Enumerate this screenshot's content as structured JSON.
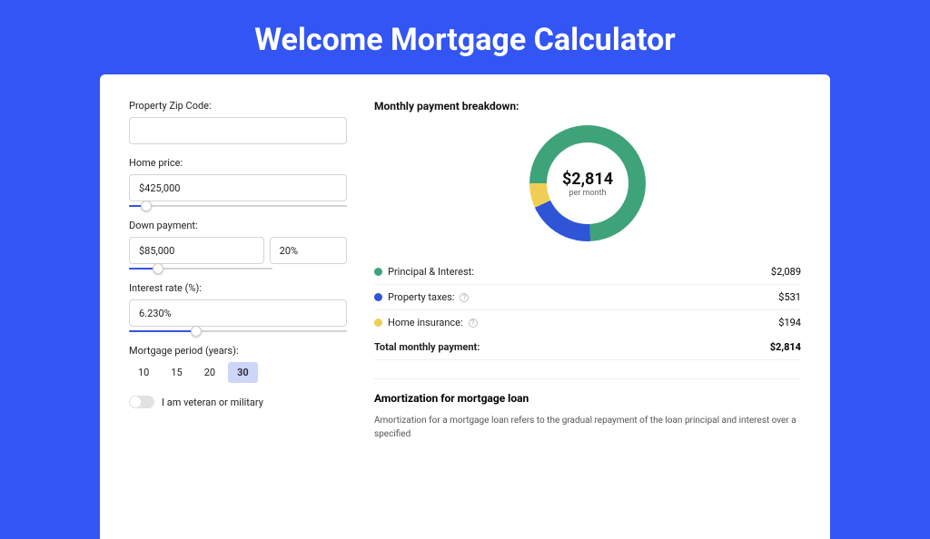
{
  "title": "Welcome Mortgage Calculator",
  "form": {
    "zip_label": "Property Zip Code:",
    "zip_value": "",
    "home_price_label": "Home price:",
    "home_price_value": "$425,000",
    "home_price_slider_pct": 8,
    "down_payment_label": "Down payment:",
    "down_payment_value": "$85,000",
    "down_payment_pct_value": "20%",
    "down_payment_slider_pct": 20,
    "rate_label": "Interest rate (%):",
    "rate_value": "6.230%",
    "rate_slider_pct": 31,
    "period_label": "Mortgage period (years):",
    "period_options": [
      "10",
      "15",
      "20",
      "30"
    ],
    "period_selected": "30",
    "veteran_label": "I am veteran or military"
  },
  "breakdown": {
    "title": "Monthly payment breakdown:",
    "center_value": "$2,814",
    "center_sub": "per month",
    "rows": [
      {
        "label": "Principal & Interest:",
        "amount": "$2,089",
        "color": "#3fa37a",
        "has_info": false
      },
      {
        "label": "Property taxes:",
        "amount": "$531",
        "color": "#2f55d6",
        "has_info": true
      },
      {
        "label": "Home insurance:",
        "amount": "$194",
        "color": "#f0ce56",
        "has_info": true
      }
    ],
    "total_label": "Total monthly payment:",
    "total_amount": "$2,814"
  },
  "amortization": {
    "title": "Amortization for mortgage loan",
    "body": "Amortization for a mortgage loan refers to the gradual repayment of the loan principal and interest over a specified"
  },
  "chart_data": {
    "type": "pie",
    "title": "Monthly payment breakdown",
    "series": [
      {
        "name": "Principal & Interest",
        "value": 2089,
        "color": "#3fa37a"
      },
      {
        "name": "Property taxes",
        "value": 531,
        "color": "#2f55d6"
      },
      {
        "name": "Home insurance",
        "value": 194,
        "color": "#f0ce56"
      }
    ],
    "total": 2814,
    "unit": "USD per month"
  }
}
